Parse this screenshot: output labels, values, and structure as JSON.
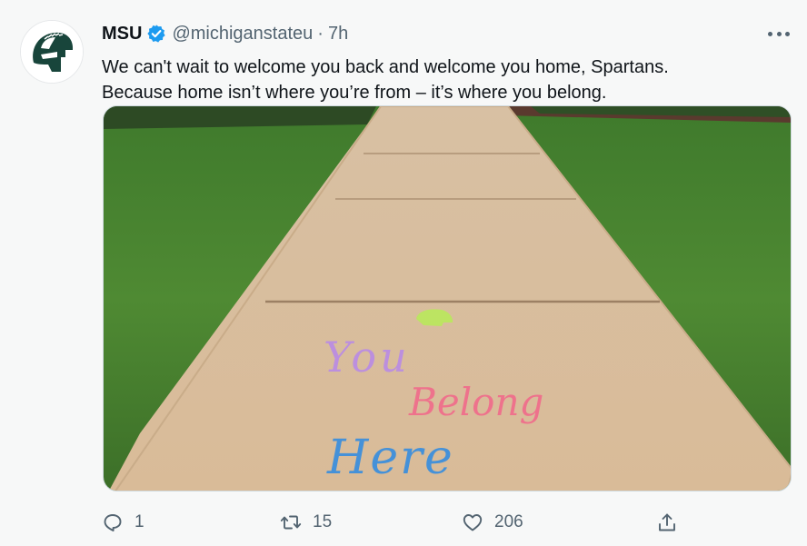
{
  "tweet": {
    "author_name": "MSU",
    "handle": "@michiganstateu",
    "separator": "·",
    "time": "7h",
    "text_line1": "We can't wait to welcome you back and welcome you home, Spartans.",
    "text_line2": "Because home isn’t where you’re from – it’s where you belong."
  },
  "media": {
    "chalk_line1": "You",
    "chalk_line2": "Belong",
    "chalk_line3": "Here"
  },
  "actions": {
    "reply_count": "1",
    "retweet_count": "15",
    "like_count": "206"
  },
  "icons": {
    "avatar": "spartan-helmet-icon",
    "verified": "verified-badge-icon",
    "more": "more-options-icon",
    "reply": "reply-icon",
    "retweet": "retweet-icon",
    "like": "heart-icon",
    "share": "share-icon"
  },
  "colors": {
    "brand_green": "#18453b",
    "verified_blue": "#1d9bf0",
    "secondary_text": "#536471",
    "chalk_purple": "#b98be6",
    "chalk_pink": "#f06f8c",
    "chalk_blue": "#3e8fdc",
    "chalk_green": "#b9e85c"
  }
}
